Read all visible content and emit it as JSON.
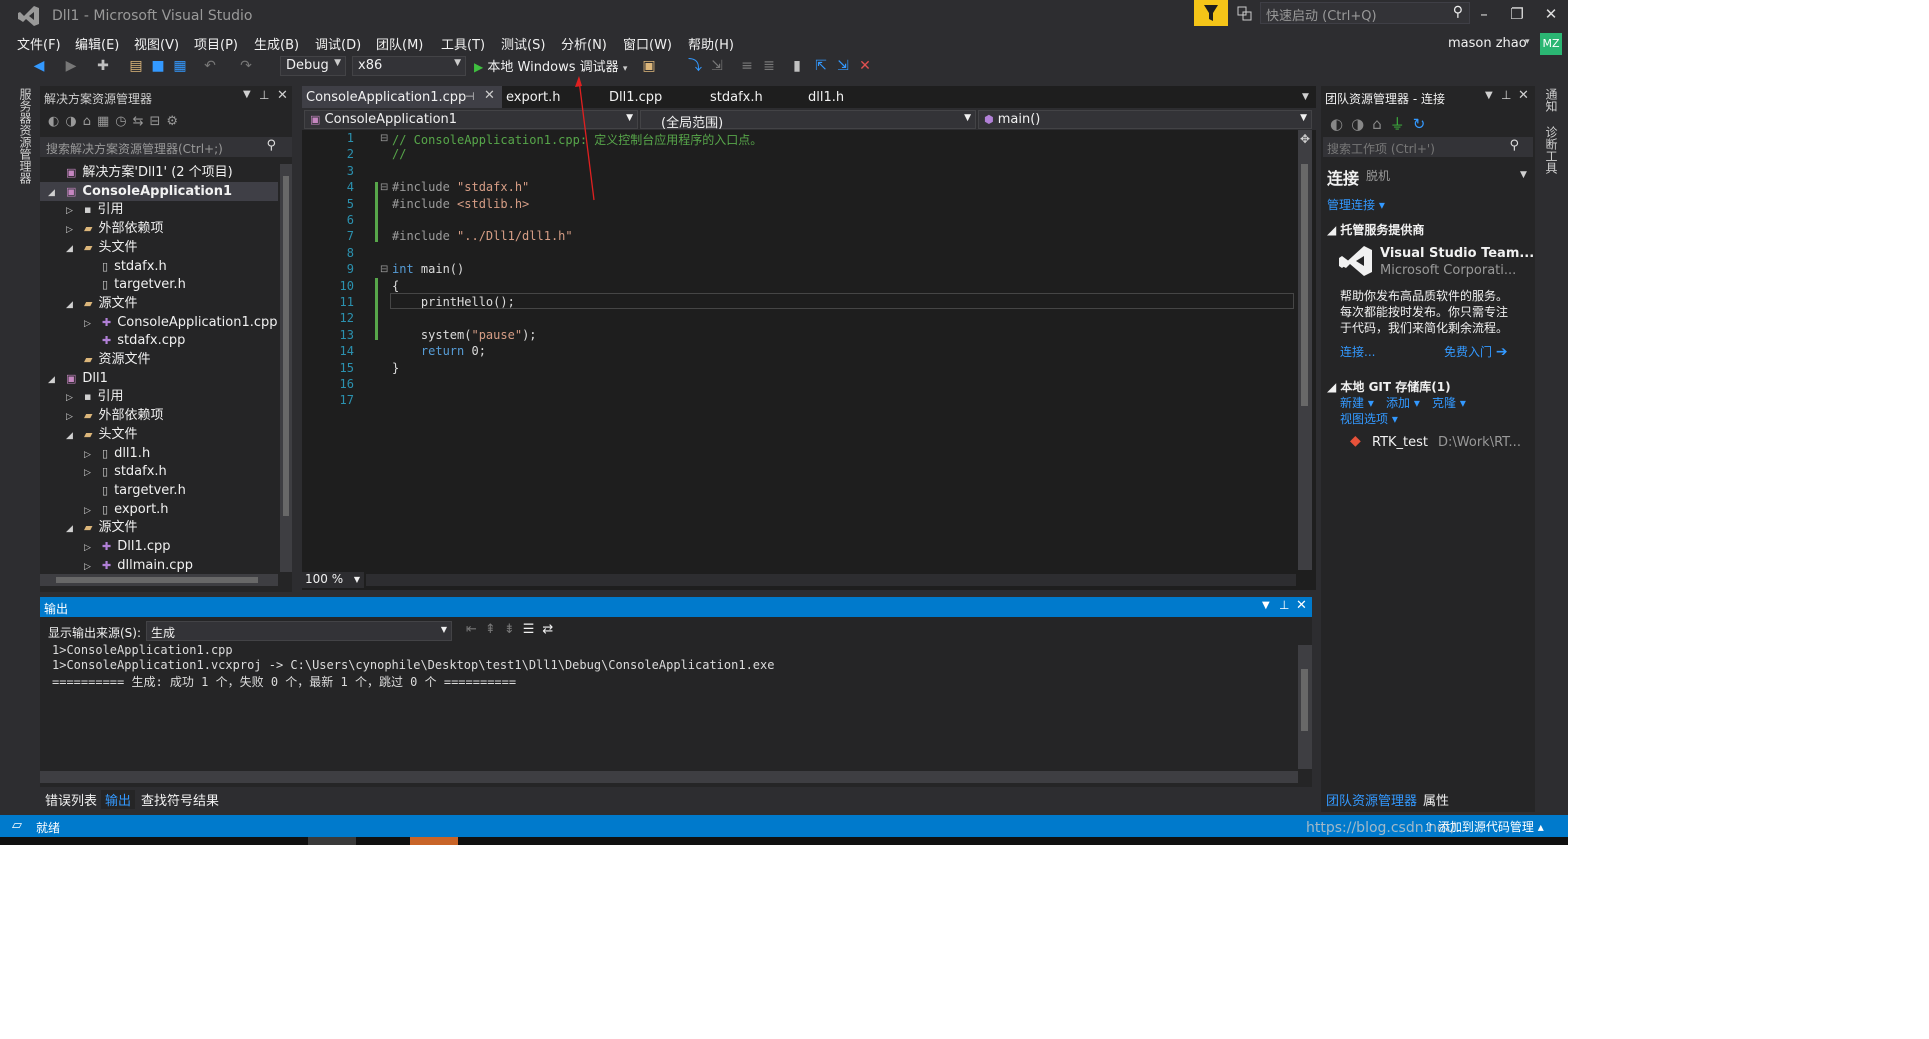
{
  "window": {
    "title": "Dll1 - Microsoft Visual Studio",
    "quick_launch_placeholder": "快速启动 (Ctrl+Q)",
    "user": "mason zhao",
    "avatar": "MZ"
  },
  "menu": [
    "文件(F)",
    "编辑(E)",
    "视图(V)",
    "项目(P)",
    "生成(B)",
    "调试(D)",
    "团队(M)",
    "工具(T)",
    "测试(S)",
    "分析(N)",
    "窗口(W)",
    "帮助(H)"
  ],
  "toolbar": {
    "config": "Debug",
    "platform": "x86",
    "run_label": "本地 Windows 调试器"
  },
  "left_strip": {
    "label": "服务器资源管理器"
  },
  "solution_explorer": {
    "title": "解决方案资源管理器",
    "search_placeholder": "搜索解决方案资源管理器(Ctrl+;)",
    "items": [
      {
        "label": "解决方案'Dll1' (2 个项目)",
        "depth": 0,
        "arrow": "",
        "icon": "solution-icon",
        "bold": false
      },
      {
        "label": "ConsoleApplication1",
        "depth": 0,
        "arrow": "◢",
        "icon": "project-icon",
        "bold": true
      },
      {
        "label": "引用",
        "depth": 1,
        "arrow": "▷",
        "icon": "references-icon",
        "bold": false
      },
      {
        "label": "外部依赖项",
        "depth": 1,
        "arrow": "▷",
        "icon": "folder-icon",
        "bold": false
      },
      {
        "label": "头文件",
        "depth": 1,
        "arrow": "◢",
        "icon": "folder-icon",
        "bold": false
      },
      {
        "label": "stdafx.h",
        "depth": 2,
        "arrow": "",
        "icon": "header-file-icon",
        "bold": false
      },
      {
        "label": "targetver.h",
        "depth": 2,
        "arrow": "",
        "icon": "header-file-icon",
        "bold": false
      },
      {
        "label": "源文件",
        "depth": 1,
        "arrow": "◢",
        "icon": "folder-icon",
        "bold": false
      },
      {
        "label": "ConsoleApplication1.cpp",
        "depth": 2,
        "arrow": "▷",
        "icon": "cpp-file-icon",
        "bold": false
      },
      {
        "label": "stdafx.cpp",
        "depth": 2,
        "arrow": "",
        "icon": "cpp-file-icon",
        "bold": false
      },
      {
        "label": "资源文件",
        "depth": 1,
        "arrow": "",
        "icon": "folder-icon",
        "bold": false
      },
      {
        "label": "Dll1",
        "depth": 0,
        "arrow": "◢",
        "icon": "project-icon",
        "bold": false
      },
      {
        "label": "引用",
        "depth": 1,
        "arrow": "▷",
        "icon": "references-icon",
        "bold": false
      },
      {
        "label": "外部依赖项",
        "depth": 1,
        "arrow": "▷",
        "icon": "folder-icon",
        "bold": false
      },
      {
        "label": "头文件",
        "depth": 1,
        "arrow": "◢",
        "icon": "folder-icon",
        "bold": false
      },
      {
        "label": "dll1.h",
        "depth": 2,
        "arrow": "▷",
        "icon": "header-file-icon",
        "bold": false
      },
      {
        "label": "stdafx.h",
        "depth": 2,
        "arrow": "▷",
        "icon": "header-file-icon",
        "bold": false
      },
      {
        "label": "targetver.h",
        "depth": 2,
        "arrow": "",
        "icon": "header-file-icon",
        "bold": false
      },
      {
        "label": "export.h",
        "depth": 2,
        "arrow": "▷",
        "icon": "header-file-icon",
        "bold": false
      },
      {
        "label": "源文件",
        "depth": 1,
        "arrow": "◢",
        "icon": "folder-icon",
        "bold": false
      },
      {
        "label": "Dll1.cpp",
        "depth": 2,
        "arrow": "▷",
        "icon": "cpp-file-icon",
        "bold": false
      },
      {
        "label": "dllmain.cpp",
        "depth": 2,
        "arrow": "▷",
        "icon": "cpp-file-icon",
        "bold": false
      }
    ]
  },
  "editor": {
    "tabs": [
      "ConsoleApplication1.cpp",
      "export.h",
      "Dll1.cpp",
      "stdafx.h",
      "dll1.h"
    ],
    "nav_project": "ConsoleApplication1",
    "nav_scope": "(全局范围)",
    "nav_member": "main()",
    "zoom": "100 %",
    "line_numbers": [
      "1",
      "2",
      "3",
      "4",
      "5",
      "6",
      "7",
      "8",
      "9",
      "10",
      "11",
      "12",
      "13",
      "14",
      "15",
      "16",
      "17"
    ],
    "lines": [
      [
        {
          "t": "// ConsoleApplication1.cpp: 定义控制台应用程序的入口点。",
          "c": "cmt"
        }
      ],
      [
        {
          "t": "//",
          "c": "cmt"
        }
      ],
      [],
      [
        {
          "t": "#include ",
          "c": "pp"
        },
        {
          "t": "\"stdafx.h\"",
          "c": "str"
        }
      ],
      [
        {
          "t": "#include ",
          "c": "pp"
        },
        {
          "t": "<stdlib.h>",
          "c": "str"
        }
      ],
      [],
      [
        {
          "t": "#include ",
          "c": "pp"
        },
        {
          "t": "\"../Dll1/dll1.h\"",
          "c": "str"
        }
      ],
      [],
      [
        {
          "t": "int",
          "c": "kw"
        },
        {
          "t": " main()",
          "c": ""
        }
      ],
      [
        {
          "t": "{",
          "c": ""
        }
      ],
      [
        {
          "t": "    printHello();",
          "c": ""
        }
      ],
      [],
      [
        {
          "t": "    system(",
          "c": ""
        },
        {
          "t": "\"pause\"",
          "c": "str"
        },
        {
          "t": ");",
          "c": ""
        }
      ],
      [
        {
          "t": "    ",
          "c": ""
        },
        {
          "t": "return",
          "c": "kw"
        },
        {
          "t": " 0;",
          "c": ""
        }
      ],
      [
        {
          "t": "}",
          "c": ""
        }
      ],
      [],
      []
    ]
  },
  "team_explorer": {
    "title": "团队资源管理器 - 连接",
    "search_placeholder": "搜索工作项 (Ctrl+')",
    "connect": "连接",
    "offline": "脱机",
    "manage": "管理连接",
    "hosted_header": "托管服务提供商",
    "vs_team": "Visual Studio Team...",
    "vs_corp": "Microsoft Corporati...",
    "desc1": "帮助你发布高品质软件的服务。",
    "desc2": "每次都能按时发布。你只需专注",
    "desc3": "于代码，我们来简化剩余流程。",
    "connect_link": "连接...",
    "free_link": "免费入门",
    "git_header": "本地 GIT 存储库(1)",
    "git_new": "新建",
    "git_add": "添加",
    "git_clone": "克隆",
    "git_view": "视图选项",
    "repo_name": "RTK_test",
    "repo_path": "D:\\Work\\RT..."
  },
  "right_strip": {
    "notify": "通知",
    "diag": "诊断工具"
  },
  "output": {
    "title": "输出",
    "source_label": "显示输出来源(S):",
    "source_value": "生成",
    "lines": [
      "1>ConsoleApplication1.cpp",
      "1>ConsoleApplication1.vcxproj -> C:\\Users\\cynophile\\Desktop\\test1\\Dll1\\Debug\\ConsoleApplication1.exe",
      "========== 生成: 成功 1 个，失败 0 个，最新 1 个，跳过 0 个 =========="
    ]
  },
  "bottom_tabs": {
    "errors": "错误列表",
    "output": "输出",
    "find": "查找符号结果",
    "team": "团队资源管理器",
    "props": "属性"
  },
  "status": {
    "ready": "就绪",
    "add_source": "添加到源代码管理",
    "watermark": "https://blog.csdn.net/..."
  },
  "colors": {
    "accent": "#007acc",
    "background": "#2d2d30",
    "editor_bg": "#1e1e1e",
    "filter_yellow": "#f5c518"
  }
}
